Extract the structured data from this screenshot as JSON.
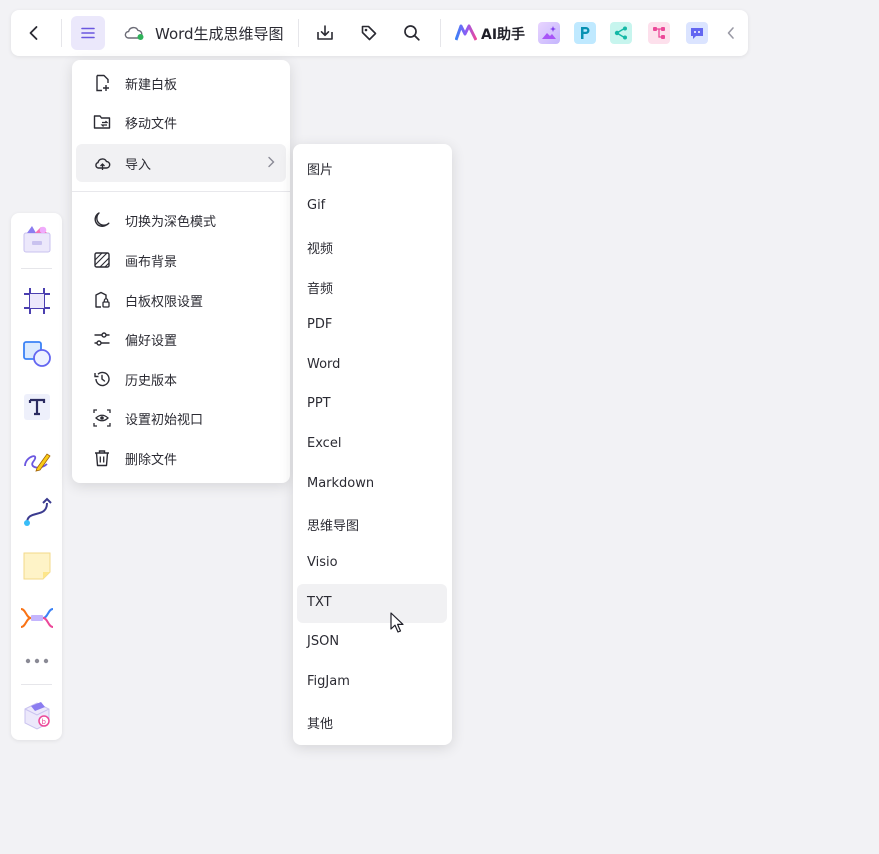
{
  "toolbar": {
    "document_title": "Word生成思维导图",
    "ai_assistant_label": "AI助手",
    "icons": [
      "back-arrow-icon",
      "hamburger-menu-icon",
      "cloud-sync-icon",
      "download-icon",
      "tag-icon",
      "search-icon",
      "ai-logo-icon",
      "ai-image-icon",
      "p-app-icon",
      "mindmap-app-icon",
      "flowchart-app-icon",
      "chat-app-icon",
      "collapse-chevron-icon"
    ],
    "accent_color": "#6b57e0"
  },
  "main_menu": {
    "items": [
      {
        "label": "新建白板",
        "icon": "new-board-icon"
      },
      {
        "label": "移动文件",
        "icon": "move-folder-icon"
      },
      {
        "label": "导入",
        "icon": "cloud-upload-icon",
        "active": true,
        "has_submenu": true
      },
      {
        "label": "切换为深色模式",
        "icon": "moon-icon"
      },
      {
        "label": "画布背景",
        "icon": "canvas-background-icon"
      },
      {
        "label": "白板权限设置",
        "icon": "permission-lock-icon"
      },
      {
        "label": "偏好设置",
        "icon": "sliders-icon"
      },
      {
        "label": "历史版本",
        "icon": "history-icon"
      },
      {
        "label": "设置初始视口",
        "icon": "viewport-eye-icon"
      },
      {
        "label": "删除文件",
        "icon": "trash-icon"
      }
    ]
  },
  "import_submenu": {
    "items": [
      {
        "label": "图片"
      },
      {
        "label": "Gif"
      },
      {
        "label": "视频"
      },
      {
        "label": "音频"
      },
      {
        "label": "PDF"
      },
      {
        "label": "Word"
      },
      {
        "label": "PPT"
      },
      {
        "label": "Excel"
      },
      {
        "label": "Markdown"
      },
      {
        "label": "思维导图"
      },
      {
        "label": "Visio"
      },
      {
        "label": "TXT",
        "hovered": true
      },
      {
        "label": "JSON"
      },
      {
        "label": "FigJam"
      },
      {
        "label": "其他"
      }
    ]
  },
  "left_rail": {
    "tools": [
      "template-icon",
      "frame-icon",
      "shape-icon",
      "text-icon",
      "pen-icon",
      "connector-icon",
      "sticky-note-icon",
      "mindmap-icon",
      "more-icon",
      "plugin-icon"
    ]
  }
}
